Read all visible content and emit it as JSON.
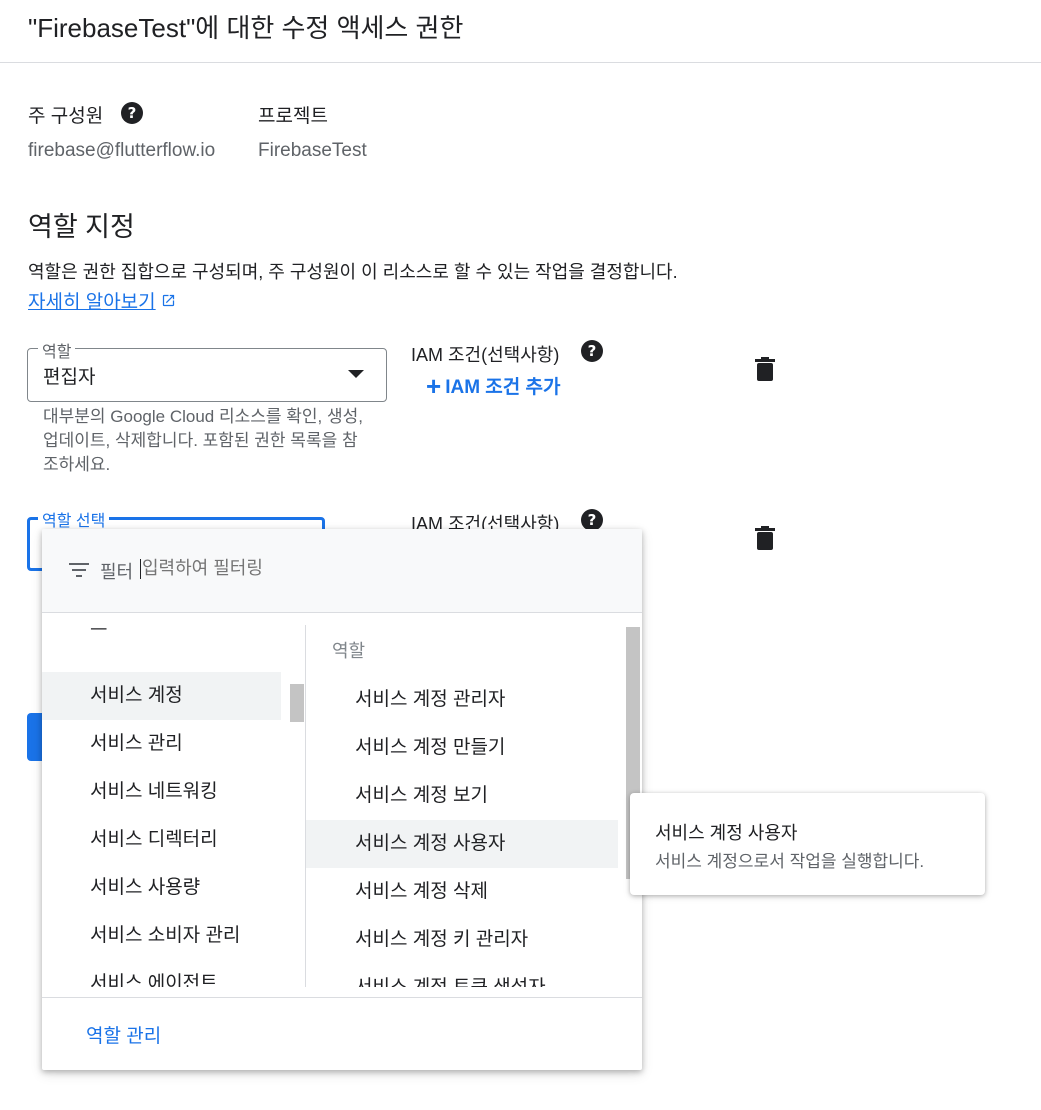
{
  "page": {
    "title": "\"FirebaseTest\"에 대한 수정 액세스 권한"
  },
  "principal": {
    "label": "주 구성원",
    "value": "firebase@flutterflow.io",
    "help_icon": "help-circle-icon"
  },
  "project": {
    "label": "프로젝트",
    "value": "FirebaseTest"
  },
  "assign_roles": {
    "title": "역할 지정",
    "description": "역할은 권한 집합으로 구성되며, 주 구성원이 이 리소스로 할 수 있는 작업을 결정합니다.",
    "learn_more": "자세히 알아보기",
    "learn_more_icon": "open-in-new-icon"
  },
  "role1": {
    "label": "역할",
    "value": "편집자",
    "description": "대부분의 Google Cloud 리소스를 확인, 생성, 업데이트, 삭제합니다. 포함된 권한 목록을 참조하세요.",
    "iam_label": "IAM 조건(선택사항)",
    "iam_add": "IAM 조건 추가",
    "delete_icon": "trash-icon"
  },
  "role2": {
    "label": "역할 선택",
    "iam_label": "IAM 조건(선택사항)",
    "delete_icon": "trash-icon"
  },
  "dropdown": {
    "filter_label": "필터",
    "filter_placeholder": "입력하여 필터링",
    "filter_icon": "filter-list-icon",
    "categories": [
      "스",
      "서비스 계정",
      "서비스 관리",
      "서비스 네트워킹",
      "서비스 디렉터리",
      "서비스 사용량",
      "서비스 소비자 관리",
      "서비스 에이전트"
    ],
    "selected_category": "서비스 계정",
    "roles_header": "역할",
    "roles": [
      "서비스 계정 관리자",
      "서비스 계정 만들기",
      "서비스 계정 보기",
      "서비스 계정 사용자",
      "서비스 계정 삭제",
      "서비스 계정 키 관리자",
      "서비스 계정 토큰 생성자"
    ],
    "hovered_role": "서비스 계정 사용자",
    "manage_roles": "역할 관리"
  },
  "tooltip": {
    "title": "서비스 계정 사용자",
    "description": "서비스 계정으로서 작업을 실행합니다."
  },
  "colors": {
    "accent": "#1a73e8",
    "text": "#202124",
    "secondary_text": "#5f6368"
  }
}
